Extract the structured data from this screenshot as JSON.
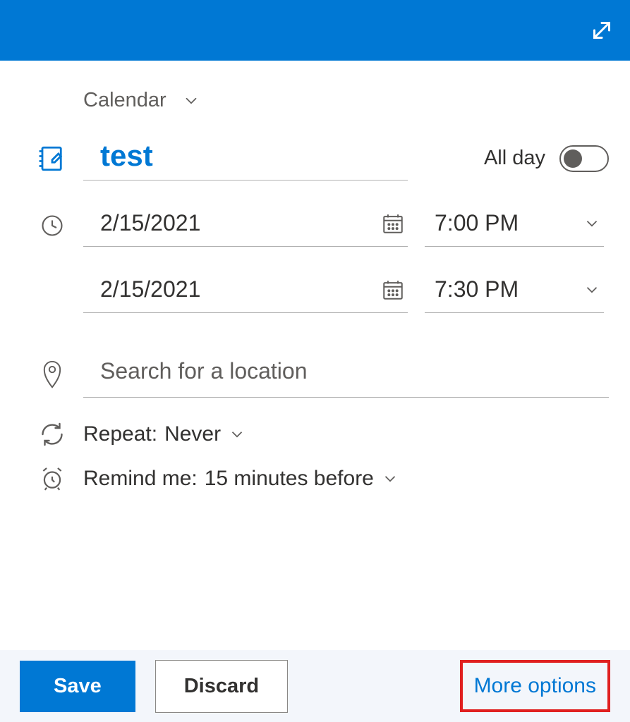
{
  "calendar_selector": {
    "label": "Calendar"
  },
  "title": {
    "value": "test"
  },
  "allday": {
    "label": "All day",
    "on": false
  },
  "start": {
    "date": "2/15/2021",
    "time": "7:00 PM"
  },
  "end": {
    "date": "2/15/2021",
    "time": "7:30 PM"
  },
  "location": {
    "placeholder": "Search for a location",
    "value": ""
  },
  "repeat": {
    "label": "Repeat:",
    "value": "Never"
  },
  "remind": {
    "label": "Remind me:",
    "value": "15 minutes before"
  },
  "footer": {
    "save": "Save",
    "discard": "Discard",
    "more": "More options"
  },
  "colors": {
    "accent": "#0078d4",
    "highlight_box": "#e02020"
  }
}
